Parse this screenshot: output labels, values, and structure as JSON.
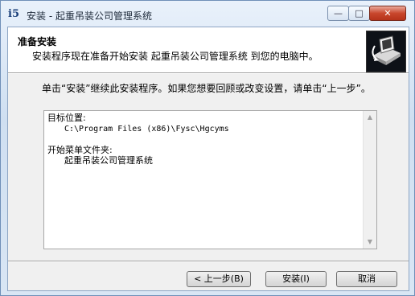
{
  "window": {
    "title": "安装 - 起重吊装公司管理系统",
    "app_icon": "i5",
    "controls": {
      "minimize": "—",
      "maximize": "□",
      "close": "✕"
    }
  },
  "header": {
    "title": "准备安装",
    "subtitle": "安装程序现在准备开始安装 起重吊装公司管理系统 到您的电脑中。"
  },
  "intro": "单击“安装”继续此安装程序。如果您想要回顾或改变设置，请单击“上一步”。",
  "memo": {
    "dest_label": "目标位置:",
    "dest_value": "C:\\Program Files (x86)\\Fysc\\Hgcyms",
    "menu_label": "开始菜单文件夹:",
    "menu_value": "起重吊装公司管理系统"
  },
  "buttons": {
    "back": "< 上一步(B)",
    "install": "安装(I)",
    "cancel": "取消"
  },
  "colors": {
    "accent": "#1b3f7a",
    "close": "#c9472d"
  }
}
